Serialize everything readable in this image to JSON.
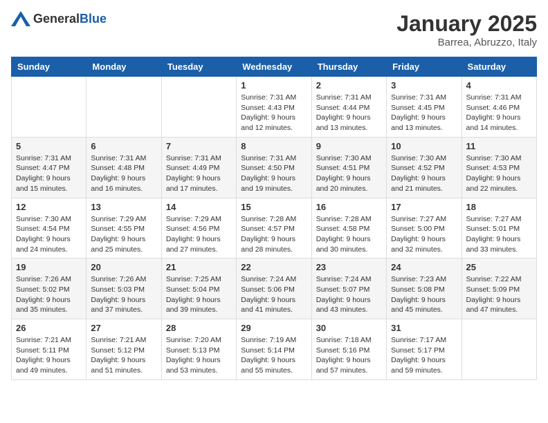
{
  "header": {
    "logo": {
      "general": "General",
      "blue": "Blue"
    },
    "title": "January 2025",
    "location": "Barrea, Abruzzo, Italy"
  },
  "weekdays": [
    "Sunday",
    "Monday",
    "Tuesday",
    "Wednesday",
    "Thursday",
    "Friday",
    "Saturday"
  ],
  "weeks": [
    [
      {
        "day": "",
        "sunrise": "",
        "sunset": "",
        "daylight": ""
      },
      {
        "day": "",
        "sunrise": "",
        "sunset": "",
        "daylight": ""
      },
      {
        "day": "",
        "sunrise": "",
        "sunset": "",
        "daylight": ""
      },
      {
        "day": "1",
        "sunrise": "Sunrise: 7:31 AM",
        "sunset": "Sunset: 4:43 PM",
        "daylight": "Daylight: 9 hours and 12 minutes."
      },
      {
        "day": "2",
        "sunrise": "Sunrise: 7:31 AM",
        "sunset": "Sunset: 4:44 PM",
        "daylight": "Daylight: 9 hours and 13 minutes."
      },
      {
        "day": "3",
        "sunrise": "Sunrise: 7:31 AM",
        "sunset": "Sunset: 4:45 PM",
        "daylight": "Daylight: 9 hours and 13 minutes."
      },
      {
        "day": "4",
        "sunrise": "Sunrise: 7:31 AM",
        "sunset": "Sunset: 4:46 PM",
        "daylight": "Daylight: 9 hours and 14 minutes."
      }
    ],
    [
      {
        "day": "5",
        "sunrise": "Sunrise: 7:31 AM",
        "sunset": "Sunset: 4:47 PM",
        "daylight": "Daylight: 9 hours and 15 minutes."
      },
      {
        "day": "6",
        "sunrise": "Sunrise: 7:31 AM",
        "sunset": "Sunset: 4:48 PM",
        "daylight": "Daylight: 9 hours and 16 minutes."
      },
      {
        "day": "7",
        "sunrise": "Sunrise: 7:31 AM",
        "sunset": "Sunset: 4:49 PM",
        "daylight": "Daylight: 9 hours and 17 minutes."
      },
      {
        "day": "8",
        "sunrise": "Sunrise: 7:31 AM",
        "sunset": "Sunset: 4:50 PM",
        "daylight": "Daylight: 9 hours and 19 minutes."
      },
      {
        "day": "9",
        "sunrise": "Sunrise: 7:30 AM",
        "sunset": "Sunset: 4:51 PM",
        "daylight": "Daylight: 9 hours and 20 minutes."
      },
      {
        "day": "10",
        "sunrise": "Sunrise: 7:30 AM",
        "sunset": "Sunset: 4:52 PM",
        "daylight": "Daylight: 9 hours and 21 minutes."
      },
      {
        "day": "11",
        "sunrise": "Sunrise: 7:30 AM",
        "sunset": "Sunset: 4:53 PM",
        "daylight": "Daylight: 9 hours and 22 minutes."
      }
    ],
    [
      {
        "day": "12",
        "sunrise": "Sunrise: 7:30 AM",
        "sunset": "Sunset: 4:54 PM",
        "daylight": "Daylight: 9 hours and 24 minutes."
      },
      {
        "day": "13",
        "sunrise": "Sunrise: 7:29 AM",
        "sunset": "Sunset: 4:55 PM",
        "daylight": "Daylight: 9 hours and 25 minutes."
      },
      {
        "day": "14",
        "sunrise": "Sunrise: 7:29 AM",
        "sunset": "Sunset: 4:56 PM",
        "daylight": "Daylight: 9 hours and 27 minutes."
      },
      {
        "day": "15",
        "sunrise": "Sunrise: 7:28 AM",
        "sunset": "Sunset: 4:57 PM",
        "daylight": "Daylight: 9 hours and 28 minutes."
      },
      {
        "day": "16",
        "sunrise": "Sunrise: 7:28 AM",
        "sunset": "Sunset: 4:58 PM",
        "daylight": "Daylight: 9 hours and 30 minutes."
      },
      {
        "day": "17",
        "sunrise": "Sunrise: 7:27 AM",
        "sunset": "Sunset: 5:00 PM",
        "daylight": "Daylight: 9 hours and 32 minutes."
      },
      {
        "day": "18",
        "sunrise": "Sunrise: 7:27 AM",
        "sunset": "Sunset: 5:01 PM",
        "daylight": "Daylight: 9 hours and 33 minutes."
      }
    ],
    [
      {
        "day": "19",
        "sunrise": "Sunrise: 7:26 AM",
        "sunset": "Sunset: 5:02 PM",
        "daylight": "Daylight: 9 hours and 35 minutes."
      },
      {
        "day": "20",
        "sunrise": "Sunrise: 7:26 AM",
        "sunset": "Sunset: 5:03 PM",
        "daylight": "Daylight: 9 hours and 37 minutes."
      },
      {
        "day": "21",
        "sunrise": "Sunrise: 7:25 AM",
        "sunset": "Sunset: 5:04 PM",
        "daylight": "Daylight: 9 hours and 39 minutes."
      },
      {
        "day": "22",
        "sunrise": "Sunrise: 7:24 AM",
        "sunset": "Sunset: 5:06 PM",
        "daylight": "Daylight: 9 hours and 41 minutes."
      },
      {
        "day": "23",
        "sunrise": "Sunrise: 7:24 AM",
        "sunset": "Sunset: 5:07 PM",
        "daylight": "Daylight: 9 hours and 43 minutes."
      },
      {
        "day": "24",
        "sunrise": "Sunrise: 7:23 AM",
        "sunset": "Sunset: 5:08 PM",
        "daylight": "Daylight: 9 hours and 45 minutes."
      },
      {
        "day": "25",
        "sunrise": "Sunrise: 7:22 AM",
        "sunset": "Sunset: 5:09 PM",
        "daylight": "Daylight: 9 hours and 47 minutes."
      }
    ],
    [
      {
        "day": "26",
        "sunrise": "Sunrise: 7:21 AM",
        "sunset": "Sunset: 5:11 PM",
        "daylight": "Daylight: 9 hours and 49 minutes."
      },
      {
        "day": "27",
        "sunrise": "Sunrise: 7:21 AM",
        "sunset": "Sunset: 5:12 PM",
        "daylight": "Daylight: 9 hours and 51 minutes."
      },
      {
        "day": "28",
        "sunrise": "Sunrise: 7:20 AM",
        "sunset": "Sunset: 5:13 PM",
        "daylight": "Daylight: 9 hours and 53 minutes."
      },
      {
        "day": "29",
        "sunrise": "Sunrise: 7:19 AM",
        "sunset": "Sunset: 5:14 PM",
        "daylight": "Daylight: 9 hours and 55 minutes."
      },
      {
        "day": "30",
        "sunrise": "Sunrise: 7:18 AM",
        "sunset": "Sunset: 5:16 PM",
        "daylight": "Daylight: 9 hours and 57 minutes."
      },
      {
        "day": "31",
        "sunrise": "Sunrise: 7:17 AM",
        "sunset": "Sunset: 5:17 PM",
        "daylight": "Daylight: 9 hours and 59 minutes."
      },
      {
        "day": "",
        "sunrise": "",
        "sunset": "",
        "daylight": ""
      }
    ]
  ]
}
